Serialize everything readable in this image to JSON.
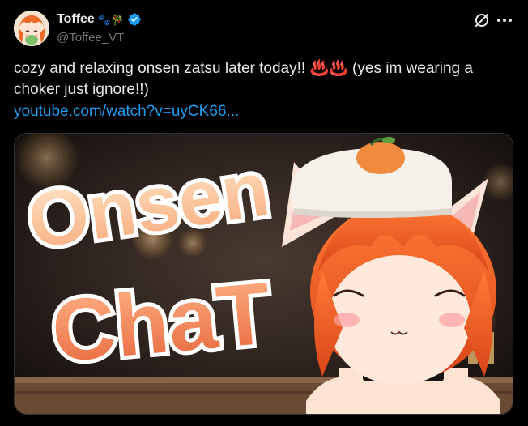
{
  "author": {
    "display_name": "Toffee",
    "name_emojis": "🐾🎋",
    "handle": "@Toffee_VT",
    "verified": true
  },
  "tweet": {
    "text_main": "cozy and relaxing onsen zatsu later today!! ",
    "hotsprings": "♨️♨️",
    "text_after": " (yes im wearing a choker just ignore!!)",
    "link": "youtube.com/watch?v=uyCK66..."
  },
  "media": {
    "thumbnail_text_line1": "Onsen",
    "thumbnail_text_line2": "ChaT"
  },
  "icons": {
    "grok": "grok-icon",
    "more": "more-icon",
    "verified": "verified-badge-icon"
  },
  "colors": {
    "link": "#1d9bf0",
    "verified": "#1d9bf0",
    "thumb_text_fill": "#ffd3ad",
    "thumb_text_outline": "#ffffff",
    "hair": "#e85a1c"
  }
}
